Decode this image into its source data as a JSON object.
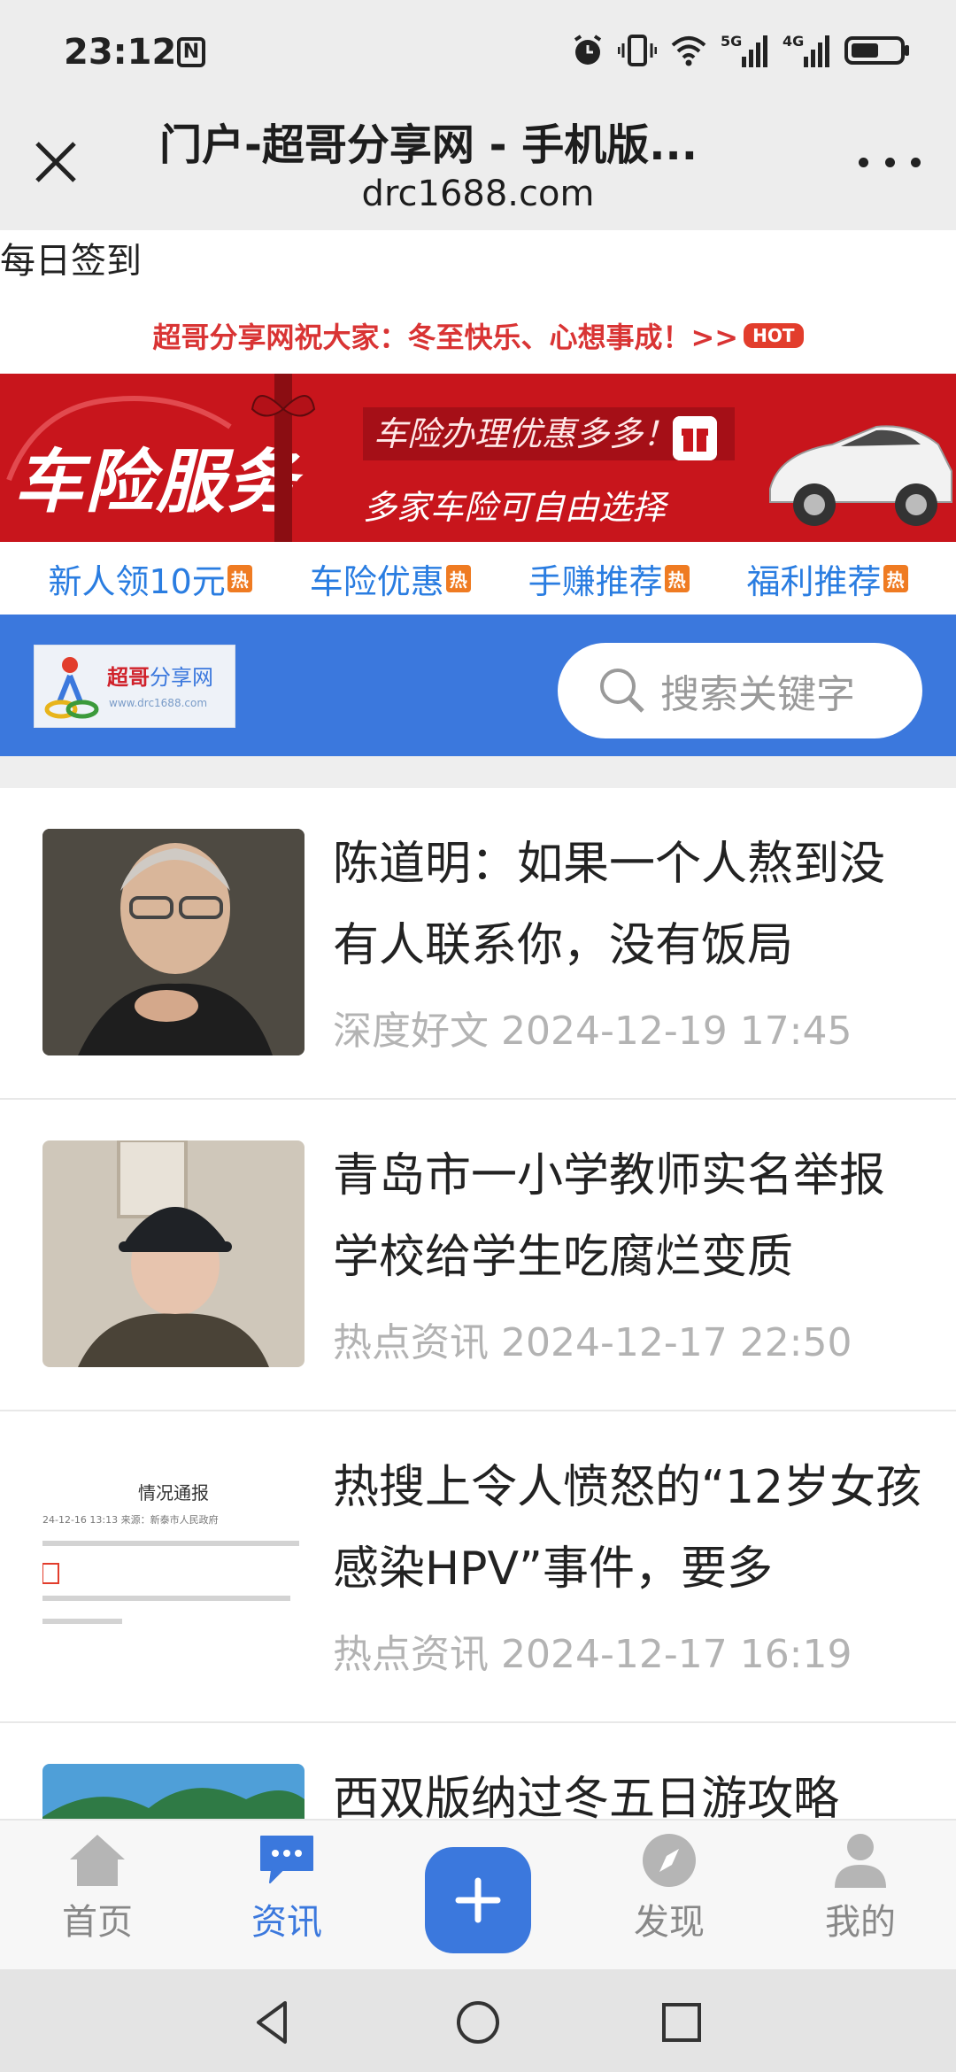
{
  "status_bar": {
    "time": "23:12",
    "nfc_label": "N",
    "icons": [
      "alarm-icon",
      "vibrate-icon",
      "wifi-icon",
      "signal-5g-icon",
      "signal-4g-icon",
      "battery-icon"
    ],
    "signal1_label": "5G",
    "signal2_label": "4G"
  },
  "browser": {
    "title": "门户-超哥分享网 - 手机版...",
    "url": "drc1688.com",
    "close_icon": "close-icon",
    "more_icon": "more-dots-icon"
  },
  "page": {
    "checkin": "每日签到",
    "marquee": "超哥分享网祝大家：冬至快乐、心想事成！>>",
    "marquee_badge": "HOT",
    "banner": {
      "main": "车险服务",
      "line1": "车险办理优惠多多！！",
      "line2": "多家车险可自由选择"
    },
    "quick_links": [
      {
        "label": "新人领10元",
        "tag": "热"
      },
      {
        "label": "车险优惠",
        "tag": "热"
      },
      {
        "label": "手赚推荐",
        "tag": "热"
      },
      {
        "label": "福利推荐",
        "tag": "热"
      }
    ],
    "logo": {
      "name_red": "超哥",
      "name_blue": "分享网",
      "sub": "www.drc1688.com"
    },
    "search_placeholder": "搜索关键字",
    "news": [
      {
        "title": "陈道明：如果一个人熬到没有人联系你，没有饭局",
        "category": "深度好文",
        "date": "2024-12-19 17:45"
      },
      {
        "title": "青岛市一小学教师实名举报学校给学生吃腐烂变质",
        "category": "热点资讯",
        "date": "2024-12-17 22:50"
      },
      {
        "title": "热搜上令人愤怒的“12岁女孩感染HPV”事件，要多",
        "category": "热点资讯",
        "date": "2024-12-17 16:19",
        "thumb_title": "情况通报",
        "thumb_meta": "24-12-16 13:13   来源：新泰市人民政府"
      },
      {
        "title": "西双版纳过冬五日游攻略",
        "category": "",
        "date": ""
      }
    ]
  },
  "bottom_nav": [
    {
      "label": "首页",
      "icon": "home-icon"
    },
    {
      "label": "资讯",
      "icon": "chat-icon"
    },
    {
      "label": "",
      "icon": "add-icon"
    },
    {
      "label": "发现",
      "icon": "compass-icon"
    },
    {
      "label": "我的",
      "icon": "user-icon"
    }
  ],
  "colors": {
    "accent": "#3b78dd",
    "banner_red": "#c8151c",
    "marquee_red": "#d93434",
    "link_blue": "#2a7de1"
  }
}
